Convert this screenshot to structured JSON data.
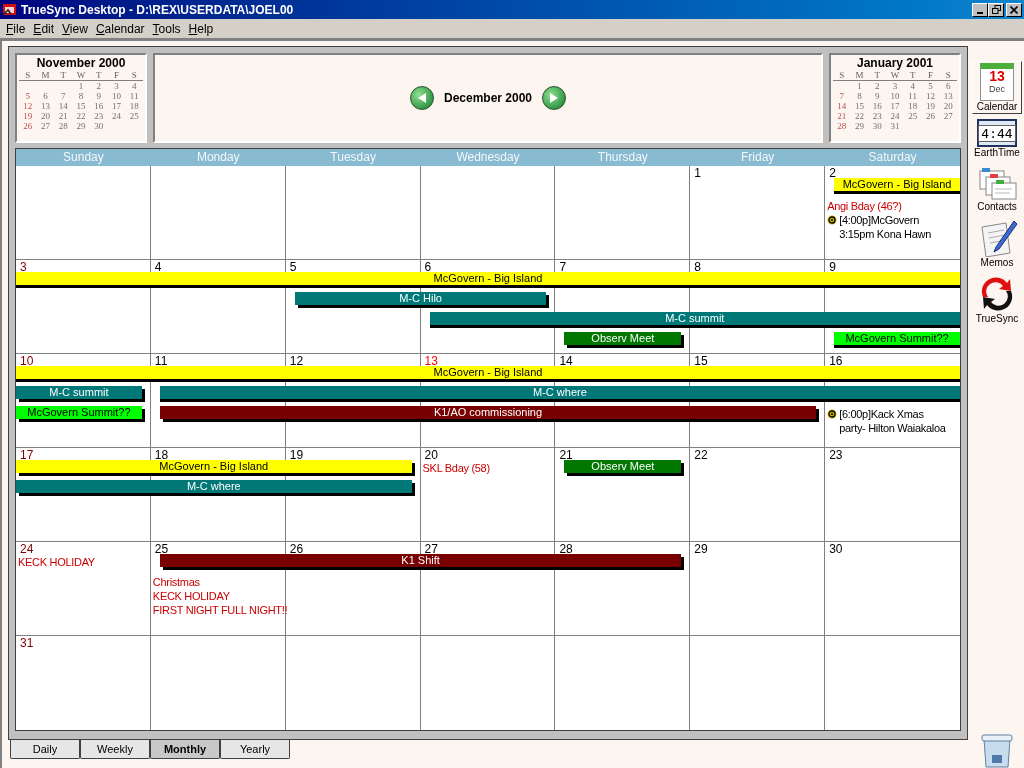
{
  "window": {
    "title": "TrueSync Desktop - D:\\REX\\USERDATA\\JOEL00"
  },
  "menu": [
    "File",
    "Edit",
    "View",
    "Calendar",
    "Tools",
    "Help"
  ],
  "mini_calendars": [
    {
      "title": "November 2000",
      "weekdays": [
        "S",
        "M",
        "T",
        "W",
        "T",
        "F",
        "S"
      ],
      "weeks": [
        [
          "1",
          "2",
          "3",
          "4"
        ],
        [
          "5",
          "6",
          "7",
          "8",
          "9",
          "10",
          "11"
        ],
        [
          "12",
          "13",
          "14",
          "15",
          "16",
          "17",
          "18"
        ],
        [
          "19",
          "20",
          "21",
          "22",
          "23",
          "24",
          "25"
        ],
        [
          "26",
          "27",
          "28",
          "29",
          "30"
        ]
      ]
    },
    {
      "title": "January 2001",
      "weekdays": [
        "S",
        "M",
        "T",
        "W",
        "T",
        "F",
        "S"
      ],
      "weeks": [
        [
          "1",
          "2",
          "3",
          "4",
          "5",
          "6"
        ],
        [
          "7",
          "8",
          "9",
          "10",
          "11",
          "12",
          "13"
        ],
        [
          "14",
          "15",
          "16",
          "17",
          "18",
          "19",
          "20"
        ],
        [
          "21",
          "22",
          "23",
          "24",
          "25",
          "26",
          "27"
        ],
        [
          "28",
          "29",
          "30",
          "31"
        ]
      ]
    }
  ],
  "month_title": "December 2000",
  "weekdays": [
    "Sunday",
    "Monday",
    "Tuesday",
    "Wednesday",
    "Thursday",
    "Friday",
    "Saturday"
  ],
  "weeks": [
    {
      "days": [
        {
          "date": "1",
          "today": false
        },
        {
          "date": "2",
          "today": false
        }
      ],
      "lanes": [
        [
          {
            "kind": "empty"
          },
          {
            "kind": "empty"
          },
          {
            "kind": "empty"
          },
          {
            "kind": "empty"
          },
          {
            "kind": "empty"
          },
          {
            "kind": "empty"
          },
          {
            "kind": "bar",
            "label": "McGovern - Big Island",
            "color": "#ffff00",
            "continues_before": false,
            "continues_after": true
          }
        ],
        [
          {
            "kind": "empty"
          },
          {
            "kind": "empty"
          },
          {
            "kind": "empty"
          },
          {
            "kind": "empty"
          },
          {
            "kind": "empty"
          },
          {
            "kind": "empty"
          },
          {
            "kind": "notes",
            "items": [
              {
                "kind": "event",
                "lines": [
                  "Angi Bday (46?)"
                ]
              },
              {
                "kind": "appointment",
                "lines": [
                  "[4:00p]McGovern",
                  "3:15pm Kona Hawn"
                ]
              }
            ]
          }
        ]
      ]
    },
    {
      "days": [
        {
          "date": "3",
          "today": false
        },
        {
          "date": "4",
          "today": false
        },
        {
          "date": "5",
          "today": false
        },
        {
          "date": "6",
          "today": false
        },
        {
          "date": "7",
          "today": false
        },
        {
          "date": "8",
          "today": false
        },
        {
          "date": "9",
          "today": false
        }
      ],
      "lanes": [
        [
          {
            "kind": "bar",
            "label": "McGovern - Big Island",
            "color": "#ffff00",
            "continues_before": true,
            "continues_after": true
          },
          {
            "kind": "continued"
          },
          {
            "kind": "continued"
          },
          {
            "kind": "continued"
          },
          {
            "kind": "continued"
          },
          {
            "kind": "continued"
          },
          {
            "kind": "continued"
          }
        ],
        [
          {
            "kind": "empty"
          },
          {
            "kind": "empty"
          },
          {
            "kind": "bar",
            "label": "M-C Hilo",
            "color": "#007878",
            "continues_before": false,
            "continues_after": false
          },
          {
            "kind": "continued"
          }
        ],
        [
          {
            "kind": "empty"
          },
          {
            "kind": "empty"
          },
          {
            "kind": "empty"
          },
          {
            "kind": "bar",
            "label": "M-C summit",
            "color": "#007878",
            "continues_before": false,
            "continues_after": true
          },
          {
            "kind": "continued"
          },
          {
            "kind": "continued"
          },
          {
            "kind": "continued"
          }
        ],
        [
          {
            "kind": "empty"
          },
          {
            "kind": "empty"
          },
          {
            "kind": "empty"
          },
          {
            "kind": "empty"
          },
          {
            "kind": "bar",
            "label": "Observ Meet",
            "color": "#007800",
            "continues_before": false,
            "continues_after": false
          },
          {
            "kind": "empty"
          },
          {
            "kind": "bar",
            "label": "McGovern Summit??",
            "color": "#00ff00",
            "continues_before": false,
            "continues_after": true
          }
        ]
      ]
    },
    {
      "days": [
        {
          "date": "10",
          "today": false
        },
        {
          "date": "11",
          "today": false
        },
        {
          "date": "12",
          "today": false
        },
        {
          "date": "13",
          "today": true
        },
        {
          "date": "14",
          "today": false
        },
        {
          "date": "15",
          "today": false
        },
        {
          "date": "16",
          "today": false
        }
      ],
      "lanes": [
        [
          {
            "kind": "bar",
            "label": "McGovern - Big Island",
            "color": "#ffff00",
            "continues_before": true,
            "continues_after": true
          },
          {
            "kind": "continued"
          },
          {
            "kind": "continued"
          },
          {
            "kind": "continued"
          },
          {
            "kind": "continued"
          },
          {
            "kind": "continued"
          },
          {
            "kind": "continued"
          }
        ],
        [
          {
            "kind": "bar",
            "label": "M-C summit",
            "color": "#007878",
            "continues_before": true,
            "continues_after": false
          },
          {
            "kind": "bar",
            "label": "M-C where",
            "color": "#007878",
            "continues_before": false,
            "continues_after": true
          },
          {
            "kind": "continued"
          },
          {
            "kind": "continued"
          },
          {
            "kind": "continued"
          },
          {
            "kind": "continued"
          },
          {
            "kind": "continued"
          }
        ],
        [
          {
            "kind": "bar",
            "label": "McGovern Summit??",
            "color": "#00ff00",
            "continues_before": true,
            "continues_after": false
          },
          {
            "kind": "bar",
            "label": "K1/AO commissioning",
            "color": "#780000",
            "continues_before": false,
            "continues_after": false
          },
          {
            "kind": "continued"
          },
          {
            "kind": "continued"
          },
          {
            "kind": "continued"
          },
          {
            "kind": "continued"
          },
          {
            "kind": "notes",
            "items": [
              {
                "kind": "appointment",
                "lines": [
                  "[6:00p]Kack Xmas",
                  "party- Hilton Waiakaloa"
                ]
              }
            ]
          }
        ]
      ]
    },
    {
      "days": [
        {
          "date": "17",
          "today": false
        },
        {
          "date": "18",
          "today": false
        },
        {
          "date": "19",
          "today": false
        },
        {
          "date": "20",
          "today": false
        },
        {
          "date": "21",
          "today": false
        },
        {
          "date": "22",
          "today": false
        },
        {
          "date": "23",
          "today": false
        }
      ],
      "lanes": [
        [
          {
            "kind": "bar",
            "label": "McGovern - Big Island",
            "color": "#ffff00",
            "continues_before": true,
            "continues_after": false
          },
          {
            "kind": "continued"
          },
          {
            "kind": "continued"
          },
          {
            "kind": "notes",
            "items": [
              {
                "kind": "event",
                "lines": [
                  "SKL Bday (58)"
                ]
              }
            ]
          },
          {
            "kind": "bar",
            "label": "Observ Meet",
            "color": "#007800",
            "continues_before": false,
            "continues_after": false
          }
        ],
        [
          {
            "kind": "bar",
            "label": "M-C where",
            "color": "#007878",
            "continues_before": true,
            "continues_after": false
          },
          {
            "kind": "continued"
          },
          {
            "kind": "continued"
          }
        ]
      ]
    },
    {
      "days": [
        {
          "date": "24",
          "today": false
        },
        {
          "date": "25",
          "today": false
        },
        {
          "date": "26",
          "today": false
        },
        {
          "date": "27",
          "today": false
        },
        {
          "date": "28",
          "today": false
        },
        {
          "date": "29",
          "today": false
        },
        {
          "date": "30",
          "today": false
        }
      ],
      "lanes": [
        [
          {
            "kind": "notes",
            "items": [
              {
                "kind": "event",
                "lines": [
                  "KECK HOLIDAY"
                ]
              }
            ]
          },
          {
            "kind": "bar",
            "label": "K1 Shift",
            "color": "#780000",
            "continues_before": false,
            "continues_after": false
          },
          {
            "kind": "continued"
          },
          {
            "kind": "continued"
          },
          {
            "kind": "continued"
          }
        ],
        [
          {
            "kind": "empty"
          },
          {
            "kind": "notes",
            "items": [
              {
                "kind": "event",
                "lines": [
                  "Christmas"
                ]
              },
              {
                "kind": "event",
                "lines": [
                  "KECK HOLIDAY"
                ]
              },
              {
                "kind": "event",
                "lines": [
                  "FIRST NIGHT FULL NIGHT!!"
                ]
              }
            ]
          }
        ]
      ]
    },
    {
      "days": [
        {
          "date": "31",
          "today": false
        }
      ]
    }
  ],
  "view_tabs": [
    {
      "label": "Daily",
      "selected": false
    },
    {
      "label": "Weekly",
      "selected": false
    },
    {
      "label": "Monthly",
      "selected": true
    },
    {
      "label": "Yearly",
      "selected": false
    }
  ],
  "sidebar": [
    {
      "kind": "calendar",
      "label": "Calendar",
      "selected": true,
      "day": "13",
      "month": "Dec"
    },
    {
      "kind": "clock",
      "label": "EarthTime",
      "selected": false,
      "time": "4:44"
    },
    {
      "kind": "contacts",
      "label": "Contacts",
      "selected": false
    },
    {
      "kind": "memos",
      "label": "Memos",
      "selected": false
    },
    {
      "kind": "sync",
      "label": "TrueSync",
      "selected": false
    }
  ]
}
